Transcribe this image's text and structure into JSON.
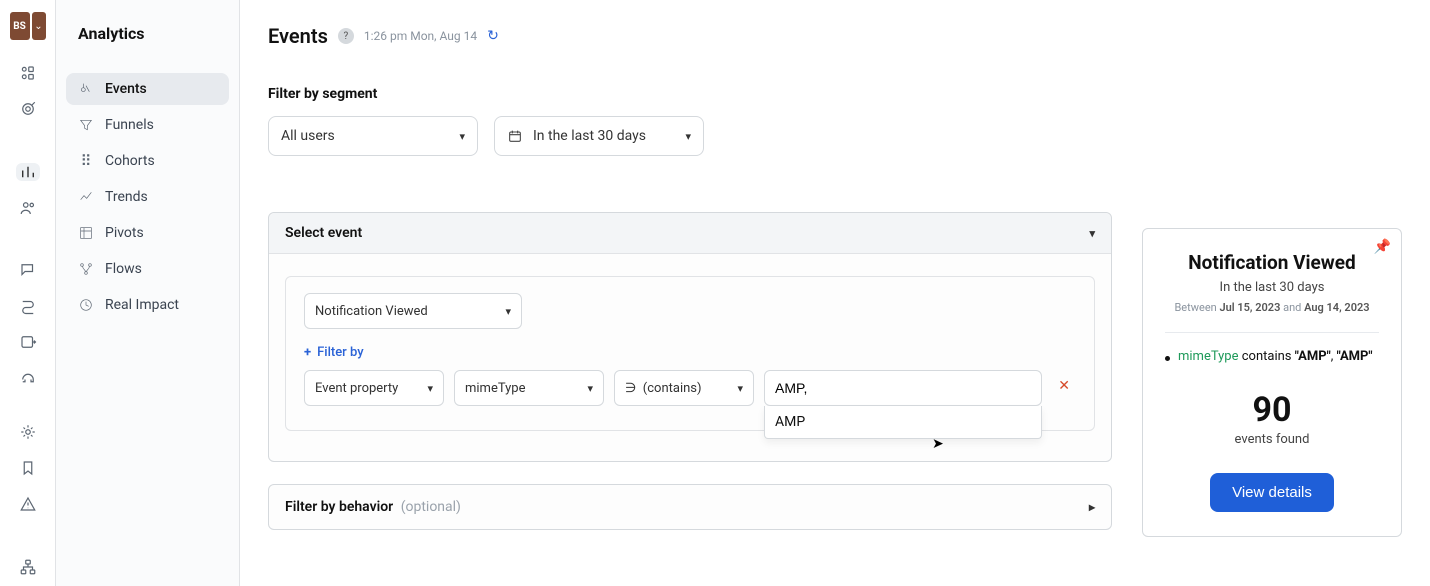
{
  "logo_text": "BS",
  "sidebar_title": "Analytics",
  "sidebar": {
    "items": [
      {
        "label": "Events"
      },
      {
        "label": "Funnels"
      },
      {
        "label": "Cohorts"
      },
      {
        "label": "Trends"
      },
      {
        "label": "Pivots"
      },
      {
        "label": "Flows"
      },
      {
        "label": "Real Impact"
      }
    ]
  },
  "page": {
    "title": "Events",
    "timestamp": "1:26 pm Mon, Aug 14"
  },
  "filter_segment": {
    "label": "Filter by segment",
    "users_dd": "All users",
    "date_dd": "In the last 30 days"
  },
  "select_event": {
    "header": "Select event",
    "event_dd": "Notification Viewed",
    "filter_by_label": "Filter by",
    "prop_type_dd": "Event property",
    "prop_name_dd": "mimeType",
    "op_symbol": "∋",
    "op_label": "(contains)",
    "value_input": "AMP,",
    "suggest": "AMP"
  },
  "behavior": {
    "label": "Filter by behavior",
    "optional": "(optional)"
  },
  "summary": {
    "title": "Notification Viewed",
    "subtitle": "In the last 30 days",
    "range_prefix": "Between",
    "range_from": "Jul 15, 2023",
    "range_mid": "and",
    "range_to": "Aug 14, 2023",
    "mt_word": "mimeType",
    "contains_word": "contains",
    "val1": "\"AMP\"",
    "val2": "\"AMP\"",
    "count": "90",
    "found": "events found",
    "button": "View details"
  }
}
